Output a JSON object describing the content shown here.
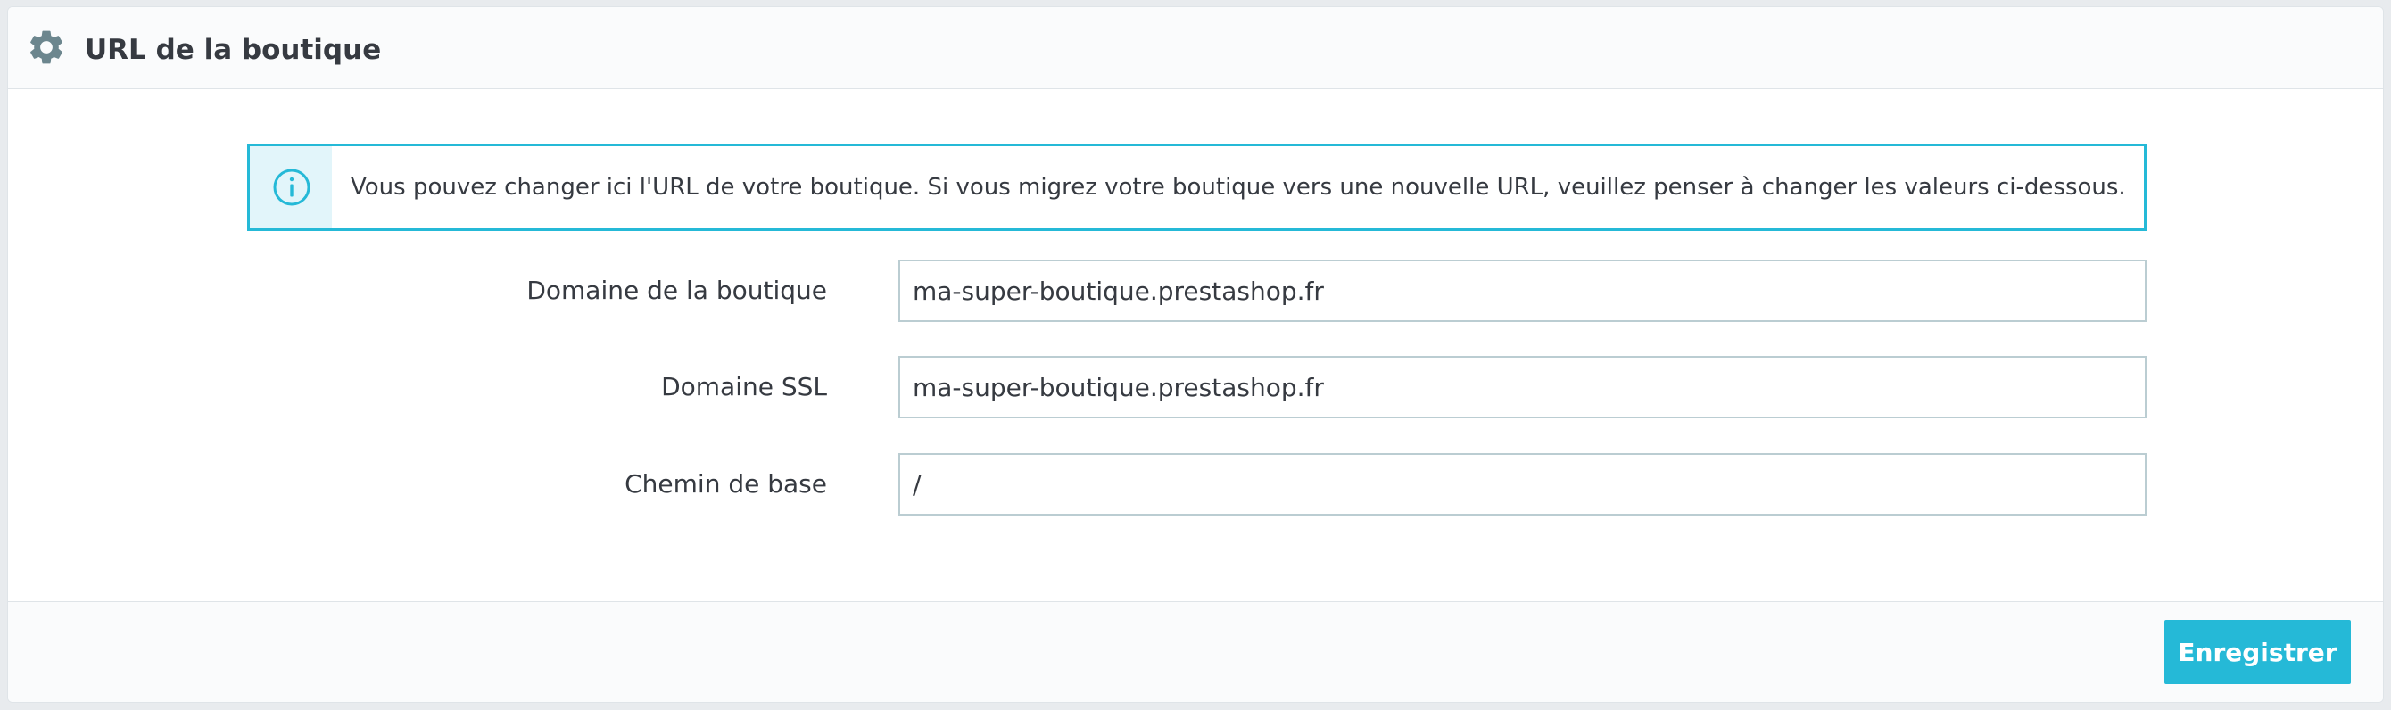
{
  "panel": {
    "title": "URL de la boutique",
    "header_icon": "gear-icon"
  },
  "alert": {
    "icon": "info-circle-icon",
    "message": "Vous pouvez changer ici l'URL de votre boutique. Si vous migrez votre boutique vers une nouvelle URL, veuillez penser à changer les valeurs ci-dessous."
  },
  "form": {
    "domain": {
      "label": "Domaine de la boutique",
      "value": "ma-super-boutique.prestashop.fr"
    },
    "ssl_domain": {
      "label": "Domaine SSL",
      "value": "ma-super-boutique.prestashop.fr"
    },
    "base_path": {
      "label": "Chemin de base",
      "value": "/"
    }
  },
  "footer": {
    "save_label": "Enregistrer"
  },
  "colors": {
    "accent": "#25b9d7",
    "alert_icon_bg": "#e2f5fa",
    "text": "#363a41",
    "icon_gray": "#6c868e",
    "input_border": "#bbcdd2"
  }
}
